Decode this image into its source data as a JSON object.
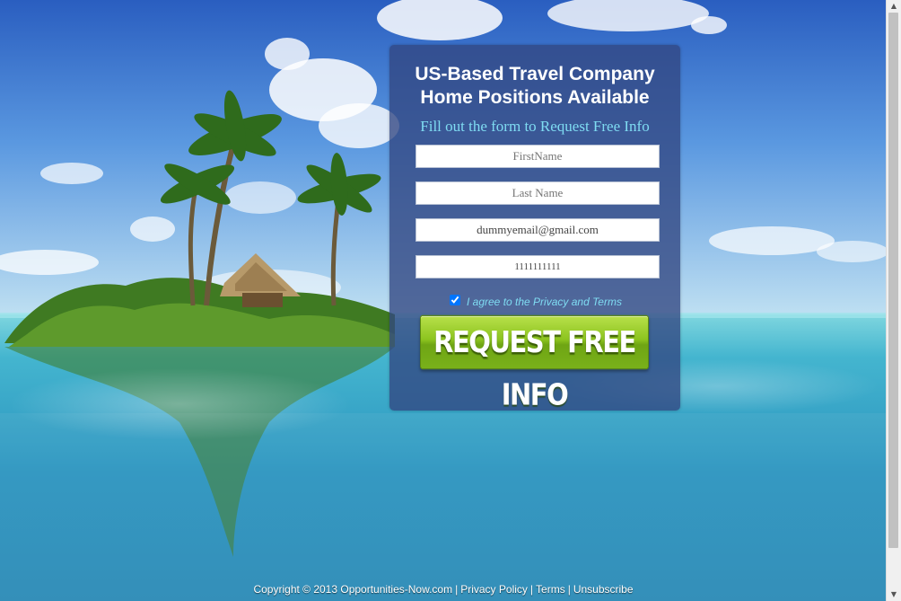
{
  "form": {
    "headline_line1": "US-Based Travel Company",
    "headline_line2": "Home Positions Available",
    "subheadline": "Fill out the form to Request Free Info",
    "first_name": {
      "value": "",
      "placeholder": "FirstName"
    },
    "last_name": {
      "value": "",
      "placeholder": "Last Name"
    },
    "email": {
      "value": "dummyemail@gmail.com",
      "placeholder": ""
    },
    "phone": {
      "value": "1111111111",
      "placeholder": ""
    },
    "agree_checked": true,
    "agree_label": "I agree to the Privacy and Terms",
    "submit_label": "REQUEST FREE INFO"
  },
  "footer": {
    "copyright": "Copyright © 2013 Opportunities-Now.com",
    "separator": "|",
    "privacy_link": "Privacy Policy",
    "terms_link": "Terms",
    "unsubscribe_link": "Unsubscribe"
  },
  "colors": {
    "panel": "#324682",
    "accent_text": "#7fdcf2",
    "button_green": "#8cc41f"
  },
  "background": {
    "scene": "tropical island with palm trees and hut over turquoise water"
  }
}
